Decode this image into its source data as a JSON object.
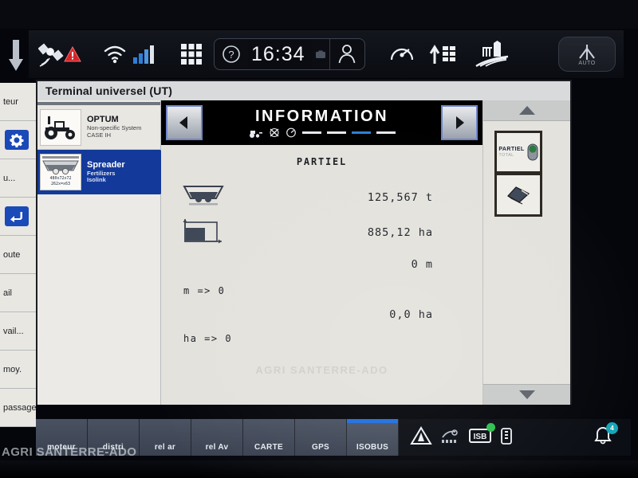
{
  "statusbar": {
    "time": "16:34",
    "auto_label": "AUTO",
    "icons": [
      {
        "name": "satellite-icon"
      },
      {
        "name": "warning-triangle-icon"
      },
      {
        "name": "wifi-icon"
      },
      {
        "name": "signal-bars-icon"
      },
      {
        "name": "apps-grid-icon"
      },
      {
        "name": "help-icon"
      },
      {
        "name": "camera-icon"
      },
      {
        "name": "user-icon"
      },
      {
        "name": "gauge-icon"
      },
      {
        "name": "implement-sections-icon"
      },
      {
        "name": "field-farm-icon"
      }
    ]
  },
  "ut": {
    "title": "Terminal universel (UT)",
    "devices": [
      {
        "name": "OPTUM",
        "sub1": "Non-specific System",
        "sub2": "CASE IH",
        "selected": false
      },
      {
        "name": "Spreader",
        "sub1": "Fertilizers",
        "sub2": "Isolink",
        "selected": true
      }
    ],
    "spreader_thumb_line1": "480x72x72",
    "spreader_thumb_line2": "262x=x63"
  },
  "information": {
    "header_title": "INFORMATION",
    "prev_label": "◀",
    "next_label": "▶",
    "panel_title": "PARTIEL",
    "watermark": "AGRI SANTERRE-ADO",
    "rows": [
      {
        "icon": "hopper-icon",
        "value": "125,567 t"
      },
      {
        "icon": "area-chart-icon",
        "value": "885,12 ha"
      },
      {
        "icon": "none",
        "value": "0 m"
      },
      {
        "icon": "none",
        "value": "0,0 ha"
      }
    ],
    "equations": [
      "m  => 0",
      "ha => 0"
    ]
  },
  "softkeys": [
    {
      "label": "PARTIEL",
      "sublabel": "TOTAL",
      "icon": "toggle-switch-icon"
    },
    {
      "label": "",
      "sublabel": "",
      "icon": "eraser-icon"
    }
  ],
  "leftmenu": {
    "items": [
      {
        "label": "teur",
        "icon": "none"
      },
      {
        "label": "",
        "icon": "gear-icon"
      },
      {
        "label": "u...",
        "icon": "none"
      },
      {
        "label": "",
        "icon": "back-arrow-icon"
      },
      {
        "label": "oute",
        "icon": "none"
      },
      {
        "label": "ail",
        "icon": "none"
      },
      {
        "label": "vail...",
        "icon": "none"
      },
      {
        "label": "moy.",
        "icon": "none"
      },
      {
        "label": "passage",
        "icon": "none"
      }
    ]
  },
  "tabbar": {
    "tabs": [
      {
        "label": "moteur",
        "active": false
      },
      {
        "label": "distri",
        "active": false
      },
      {
        "label": "rel ar",
        "active": false
      },
      {
        "label": "rel Av",
        "active": false
      },
      {
        "label": "CARTE",
        "active": false
      },
      {
        "label": "GPS",
        "active": false
      },
      {
        "label": "ISOBUS",
        "active": true
      }
    ],
    "tray_icons": [
      {
        "name": "warning-triangle-icon"
      },
      {
        "name": "implement-status-icon"
      },
      {
        "name": "isb-icon"
      },
      {
        "name": "battery-icon"
      }
    ],
    "bell_badge": "4"
  },
  "watermark_corner": "AGRI SANTERRE-ADO",
  "colors": {
    "accent_blue": "#1f6fe0",
    "selected_blue": "#133a9b",
    "warning_red": "#d4262a",
    "badge_teal": "#17a6b8"
  }
}
